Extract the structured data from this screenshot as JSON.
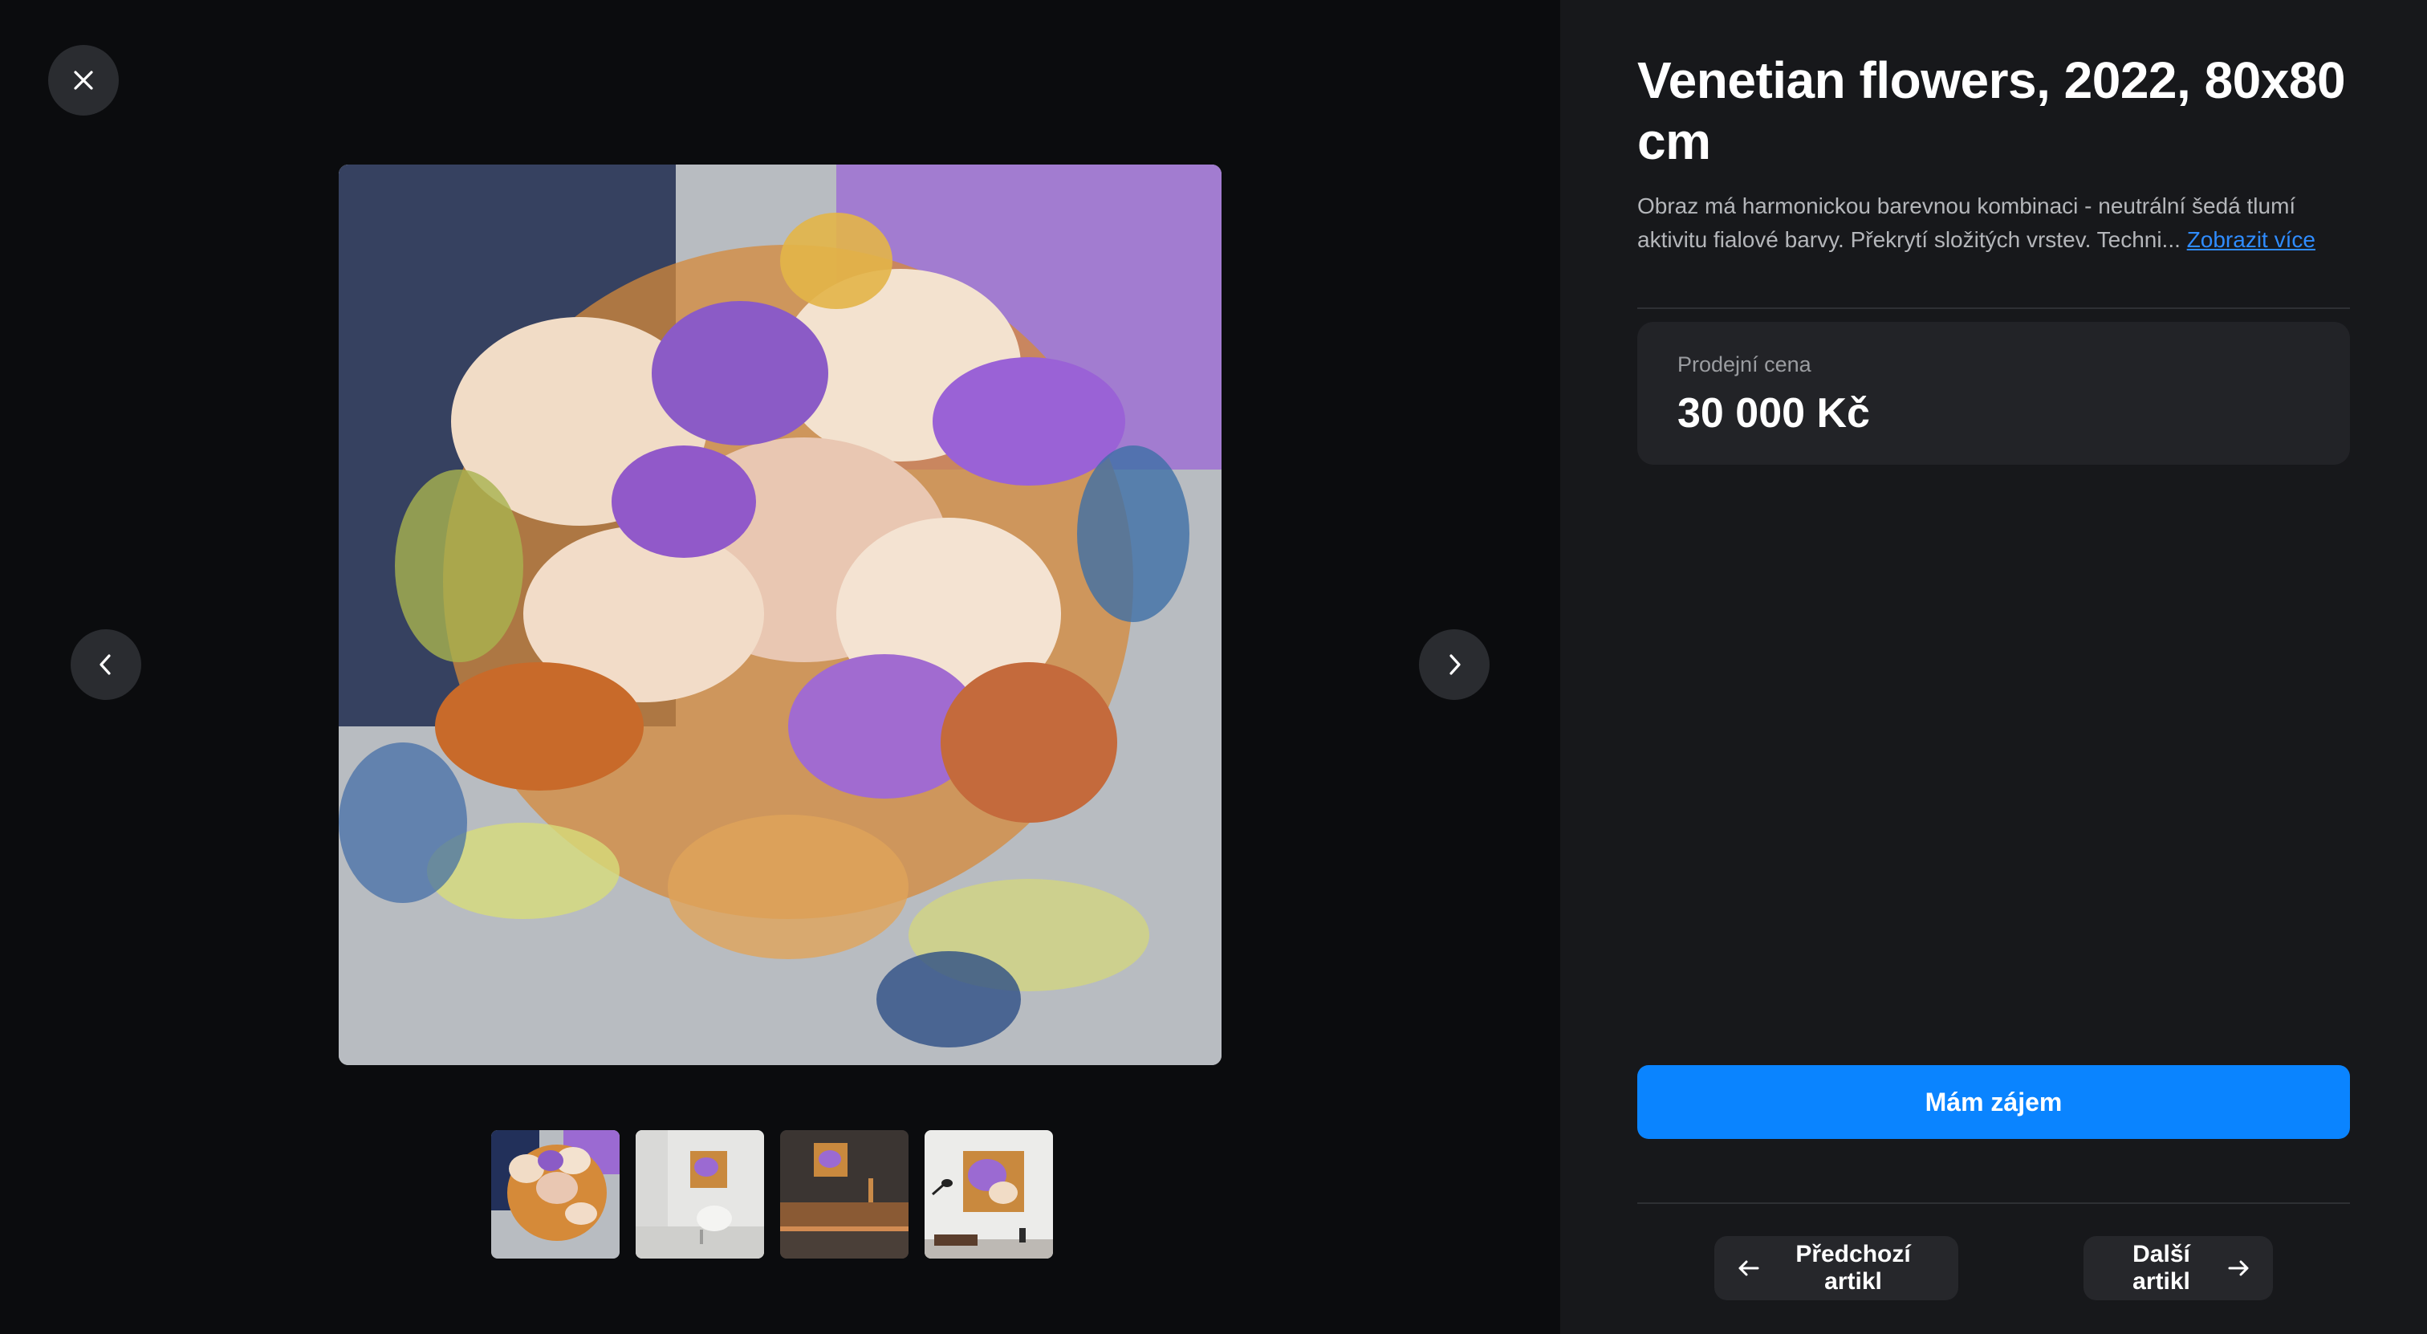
{
  "gallery": {
    "close_icon": "close-icon",
    "prev_icon": "chevron-left-icon",
    "next_icon": "chevron-right-icon",
    "thumbnails": [
      {
        "name": "thumbnail-painting"
      },
      {
        "name": "thumbnail-white-room"
      },
      {
        "name": "thumbnail-dark-room"
      },
      {
        "name": "thumbnail-lounge-room"
      }
    ]
  },
  "panel": {
    "title": "Venetian flowers, 2022, 80x80 cm",
    "description": "Obraz má harmonickou barevnou kombinaci - neutrální šedá tlumí aktivitu fialové barvy. Překrytí složitých vrstev. Techni...",
    "show_more": "Zobrazit více",
    "price_label": "Prodejní cena",
    "price_value": "30 000 Kč",
    "cta_label": "Mám zájem",
    "prev_article": "Předchozí artikl",
    "next_article": "Další artikl"
  },
  "colors": {
    "accent": "#0a84ff",
    "link": "#2f8cff",
    "panel_bg": "#17181b",
    "gallery_bg": "#0b0c0e"
  }
}
